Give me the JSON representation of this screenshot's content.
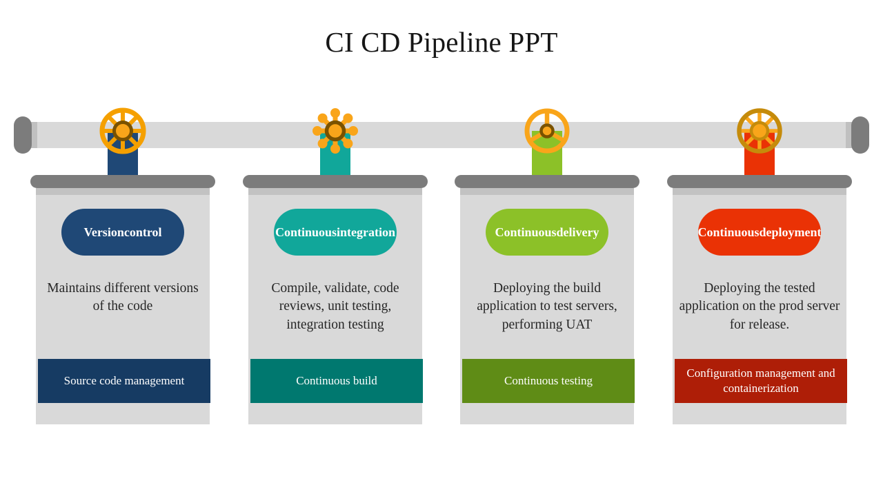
{
  "slide": {
    "title": "CI CD Pipeline PPT",
    "background": "#ffffff"
  },
  "pipe": {
    "body_color": "#d9d9d9",
    "flange_color": "#c0c0c0",
    "cap_color": "#7c7c7c"
  },
  "card_style": {
    "cap_color": "#7c7c7c",
    "shoulder_color": "#c2c2c2",
    "body_color": "#d9d9d9",
    "desc_color": "#262626"
  },
  "stages": [
    {
      "id": "version-control",
      "title": "Version\ncontrol",
      "title_line1": "Version",
      "title_line2": "control",
      "description": "Maintains different versions of the code",
      "footer": "Source code management",
      "pill_color": "#1f4876",
      "footer_color": "#163b63",
      "stem_color": "#1f4876",
      "valve_icon": "spoked-valve-wheel-icon",
      "valve_style": "spoked-wheel",
      "valve_ring_color": "#f5a000",
      "valve_hub_color": "#7a5200",
      "valve_center_color": "#f9a51a"
    },
    {
      "id": "continuous-integration",
      "title": "Continuous\nintegration",
      "title_line1": "Continuous",
      "title_line2": "integration",
      "description": "Compile, validate, code reviews, unit testing, integration testing",
      "footer": "Continuous build",
      "pill_color": "#11a79a",
      "footer_color": "#00786f",
      "stem_color": "#11a79a",
      "valve_icon": "knobbed-star-valve-icon",
      "valve_style": "knobbed-star",
      "valve_ring_color": "#f9a51a",
      "valve_hub_color": "#7a5200",
      "valve_center_color": "#f9a51a"
    },
    {
      "id": "continuous-delivery",
      "title": "Continuous\ndelivery",
      "title_line1": "Continuous",
      "title_line2": "delivery",
      "description": "Deploying the build application to test servers, performing UAT",
      "footer": "Continuous testing",
      "pill_color": "#8cc128",
      "footer_color": "#5f8c16",
      "stem_color": "#8cc128",
      "valve_icon": "steering-wheel-valve-icon",
      "valve_style": "steering-wheel",
      "valve_ring_color": "#f9a51a",
      "valve_hub_color": "#7a5200",
      "valve_center_color": "#f9a51a"
    },
    {
      "id": "continuous-deployment",
      "title": "Continuous\ndeployment",
      "title_line1": "Continuous",
      "title_line2": "deployment",
      "description": "Deploying the tested application on the prod server for release.",
      "footer": "Configuration management and containerization",
      "pill_color": "#ea3205",
      "footer_color": "#ae1e07",
      "stem_color": "#ea3205",
      "valve_icon": "dark-rim-wheel-valve-icon",
      "valve_style": "dark-rim-wheel",
      "valve_ring_color": "#c58b0b",
      "valve_hub_color": "#c58b0b",
      "valve_center_color": "#f9a51a"
    }
  ]
}
